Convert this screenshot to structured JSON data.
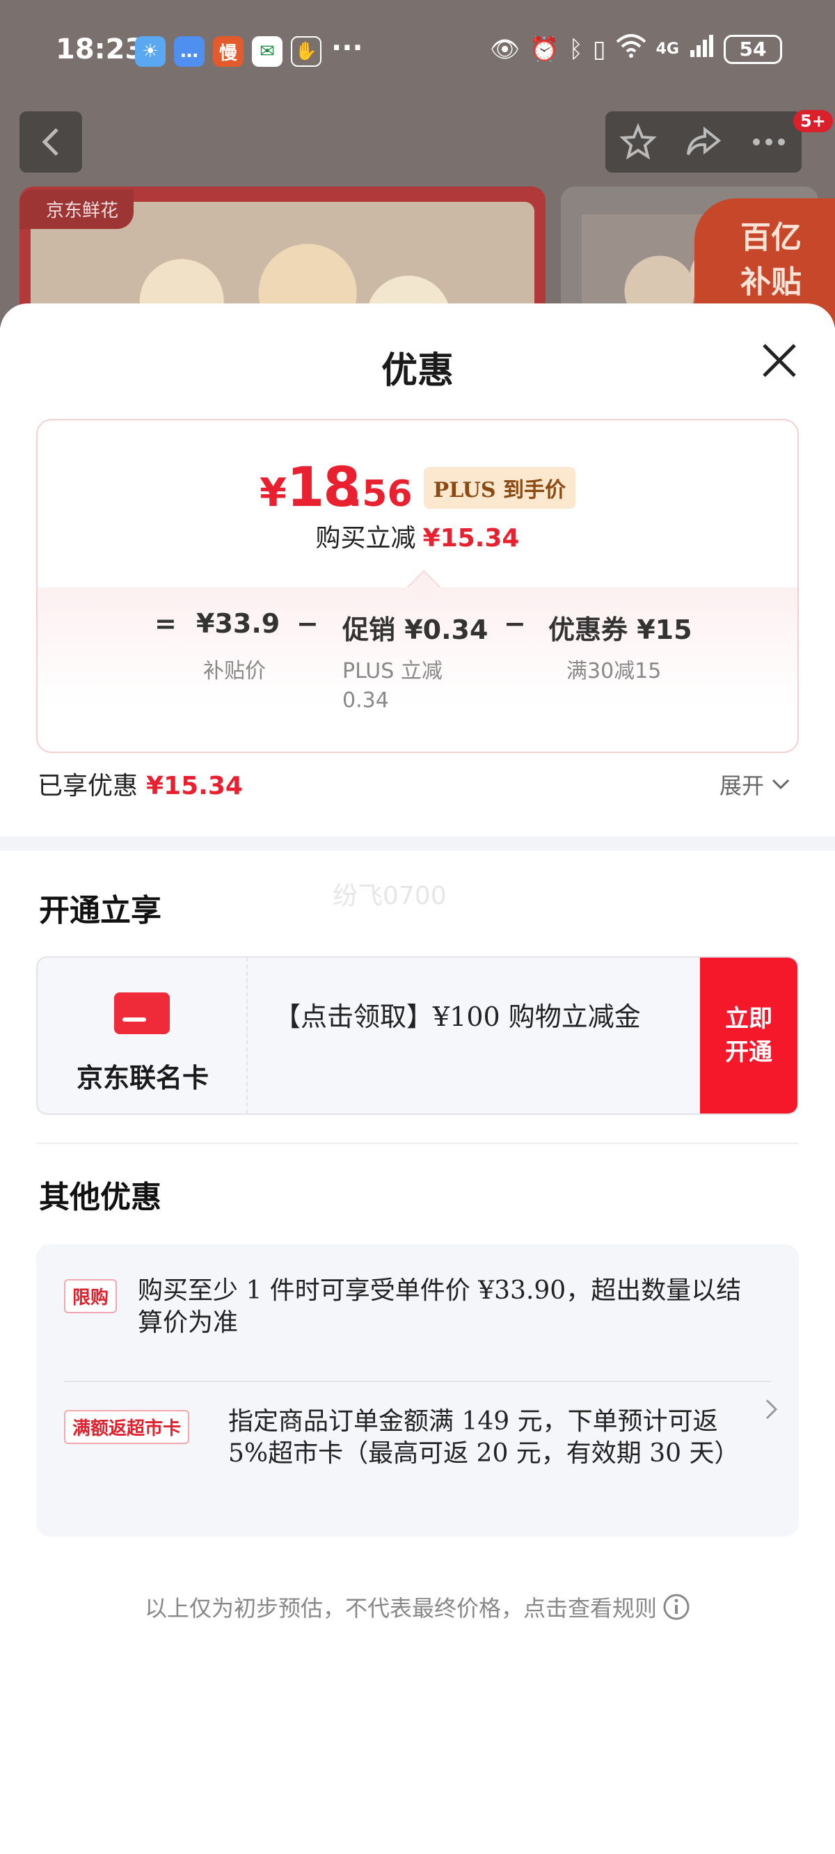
{
  "status_bar": {
    "time": "18:23",
    "more": "···",
    "network": "4G",
    "battery": "54"
  },
  "background_page": {
    "fresh_tag": "京东鲜花",
    "subsidy_line1": "百亿",
    "subsidy_line2": "补贴",
    "badge": "5+"
  },
  "sheet": {
    "title": "优惠",
    "price": {
      "yen": "¥",
      "integer": "18",
      "decimal": ".56",
      "plus_tag": "PLUS 到手价",
      "buy_label": "购买立减",
      "buy_amount": "¥15.34"
    },
    "breakdown": {
      "equals": "=",
      "item1": "¥33.9",
      "item1_sub": "补贴价",
      "minus1": "−",
      "item2": "促销 ¥0.34",
      "item2_sub1": "PLUS 立减",
      "item2_sub2": "0.34",
      "minus2": "−",
      "item3": "优惠券 ¥15",
      "item3_sub": "满30减15"
    },
    "enjoyed_label": "已享优惠",
    "enjoyed_amount": "¥15.34",
    "expand_label": "展开"
  },
  "open_section": {
    "title": "开通立享",
    "watermark": "纷飞0700",
    "card_name": "京东联名卡",
    "card_text": "【点击领取】¥100 购物立减金",
    "button_line1": "立即",
    "button_line2": "开通"
  },
  "other_section": {
    "title": "其他优惠",
    "offers": [
      {
        "tag": "限购",
        "text": "购买至少 1 件时可享受单件价 ¥33.90，超出数量以结算价为准"
      },
      {
        "tag": "满额返超市卡",
        "text": "指定商品订单金额满 149 元，下单预计可返 5%超市卡（最高可返 20 元，有效期 30 天）"
      }
    ]
  },
  "footnote": "以上仅为初步预估，不代表最终价格，点击查看规则",
  "colors": {
    "accent_red": "#e8202f",
    "button_red": "#f5172a",
    "plus_tag_bg": "#fbe8cf",
    "plus_tag_text": "#8b4a12"
  }
}
